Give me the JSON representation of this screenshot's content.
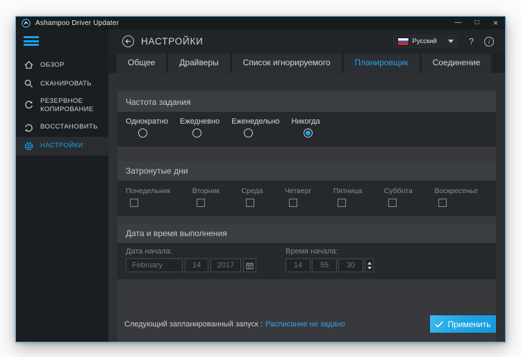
{
  "window": {
    "title": "Ashampoo Driver Updater",
    "controls": {
      "minimize": "—",
      "maximize": "□",
      "close": "×"
    }
  },
  "colors": {
    "accent": "#14a5e8",
    "link": "#3aa0e4",
    "active_tab_text": "#2aa2e2",
    "apply_button": "#1ea6e6",
    "flag_stripes": [
      "#f2f3f4",
      "#2d55a5",
      "#d5281e"
    ]
  },
  "sidebar": {
    "items": [
      {
        "label": "ОБЗОР",
        "icon": "home-icon",
        "active": false
      },
      {
        "label": "СКАНИРОВАТЬ",
        "icon": "search-icon",
        "active": false
      },
      {
        "label": "РЕЗЕРВНОЕ КОПИРОВАНИЕ",
        "icon": "backup-icon",
        "active": false
      },
      {
        "label": "ВОССТАНОВИТЬ",
        "icon": "restore-icon",
        "active": false
      },
      {
        "label": "НАСТРОЙКИ",
        "icon": "gear-icon",
        "active": true
      }
    ]
  },
  "header": {
    "title": "НАСТРОЙКИ",
    "language": {
      "label": "Русский",
      "flag": "russian-flag"
    },
    "help": "?",
    "info": "i"
  },
  "tabs": [
    {
      "label": "Общее",
      "active": false
    },
    {
      "label": "Драйверы",
      "active": false
    },
    {
      "label": "Список игнорируемого",
      "active": false
    },
    {
      "label": "Планировщик",
      "active": true
    },
    {
      "label": "Соединение",
      "active": false
    }
  ],
  "sections": {
    "frequency": {
      "title": "Частота задания",
      "options": [
        {
          "label": "Однократно",
          "selected": false
        },
        {
          "label": "Ежедневно",
          "selected": false
        },
        {
          "label": "Еженедельно",
          "selected": false
        },
        {
          "label": "Никогда",
          "selected": true
        }
      ]
    },
    "days": {
      "title": "Затронутые дни",
      "items": [
        {
          "label": "Понедельник",
          "checked": false
        },
        {
          "label": "Вторник",
          "checked": false
        },
        {
          "label": "Среда",
          "checked": false
        },
        {
          "label": "Четверг",
          "checked": false
        },
        {
          "label": "Пятница",
          "checked": false
        },
        {
          "label": "Суббота",
          "checked": false
        },
        {
          "label": "Воскресенье",
          "checked": false
        }
      ]
    },
    "datetime": {
      "title": "Дата и время выполнения",
      "start_date": {
        "label": "Дата начала:",
        "month": "February",
        "day": "14",
        "year": "2017"
      },
      "start_time": {
        "label": "Время начала:",
        "hour": "14",
        "minute": "55",
        "second": "30"
      }
    }
  },
  "footer": {
    "status_label": "Следующий запланированный запуск :",
    "status_value": "Расписание не задано",
    "apply_label": "Применить"
  }
}
